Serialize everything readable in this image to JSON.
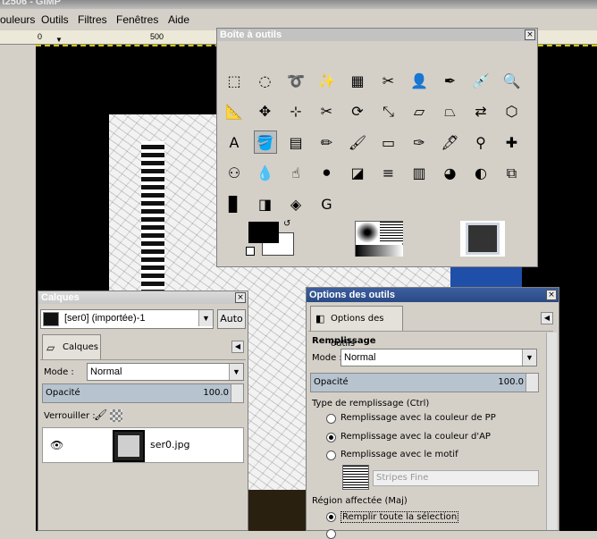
{
  "window": {
    "title": "t2506 - GIMP"
  },
  "menu": [
    "ouleurs",
    "Outils",
    "Filtres",
    "Fenêtres",
    "Aide"
  ],
  "ruler": {
    "tick0": "0",
    "tick500": "500"
  },
  "toolbox": {
    "title": "Boîte à outils",
    "close": "×",
    "tools": [
      {
        "name": "rect-select-icon",
        "glyph": "⬚"
      },
      {
        "name": "ellipse-select-icon",
        "glyph": "◌"
      },
      {
        "name": "lasso-icon",
        "glyph": "➰"
      },
      {
        "name": "fuzzy-select-icon",
        "glyph": "✨"
      },
      {
        "name": "select-by-color-icon",
        "glyph": "▦"
      },
      {
        "name": "scissors-icon",
        "glyph": "✂"
      },
      {
        "name": "foreground-select-icon",
        "glyph": "👤"
      },
      {
        "name": "paths-icon",
        "glyph": "✒"
      },
      {
        "name": "color-picker-icon",
        "glyph": "💉"
      },
      {
        "name": "zoom-icon",
        "glyph": "🔍"
      },
      {
        "name": "measure-icon",
        "glyph": "📐"
      },
      {
        "name": "move-icon",
        "glyph": "✥"
      },
      {
        "name": "align-icon",
        "glyph": "⊹"
      },
      {
        "name": "crop-icon",
        "glyph": "✂"
      },
      {
        "name": "rotate-icon",
        "glyph": "⟳"
      },
      {
        "name": "scale-icon",
        "glyph": "⤡"
      },
      {
        "name": "shear-icon",
        "glyph": "▱"
      },
      {
        "name": "perspective-icon",
        "glyph": "⏢"
      },
      {
        "name": "flip-icon",
        "glyph": "⇄"
      },
      {
        "name": "cage-icon",
        "glyph": "⬡"
      },
      {
        "name": "text-icon",
        "glyph": "A"
      },
      {
        "name": "bucket-fill-icon",
        "glyph": "🪣"
      },
      {
        "name": "blend-icon",
        "glyph": "▤"
      },
      {
        "name": "pencil-icon",
        "glyph": "✏"
      },
      {
        "name": "paintbrush-icon",
        "glyph": "🖌"
      },
      {
        "name": "eraser-icon",
        "glyph": "▭"
      },
      {
        "name": "airbrush-icon",
        "glyph": "✑"
      },
      {
        "name": "ink-icon",
        "glyph": "🖋"
      },
      {
        "name": "clone-icon",
        "glyph": "⚲"
      },
      {
        "name": "heal-icon",
        "glyph": "✚"
      },
      {
        "name": "perspective-clone-icon",
        "glyph": "⚇"
      },
      {
        "name": "blur-icon",
        "glyph": "💧"
      },
      {
        "name": "smudge-icon",
        "glyph": "☝"
      },
      {
        "name": "dodge-burn-icon",
        "glyph": "⚫"
      },
      {
        "name": "desaturate-icon",
        "glyph": "◪"
      },
      {
        "name": "levels-icon",
        "glyph": "≡"
      },
      {
        "name": "colorize-icon",
        "glyph": "▥"
      },
      {
        "name": "color-balance-icon",
        "glyph": "◕"
      },
      {
        "name": "threshold-icon",
        "glyph": "◐"
      },
      {
        "name": "curves-icon",
        "glyph": "⧉"
      },
      {
        "name": "histogram-icon",
        "glyph": "▊"
      },
      {
        "name": "posterize-icon",
        "glyph": "◨"
      },
      {
        "name": "hue-sat-icon",
        "glyph": "◈"
      },
      {
        "name": "gimp-g-icon",
        "glyph": "G"
      }
    ]
  },
  "layers": {
    "title": "Calques",
    "close": "×",
    "image_select": "[ser0] (importée)-1",
    "auto": "Auto",
    "tab": "Calques",
    "mode_label": "Mode :",
    "mode_value": "Normal",
    "opacity_label": "Opacité",
    "opacity_value": "100.0",
    "lock_label": "Verrouiller :",
    "layer_name": "ser0.jpg"
  },
  "tool_options": {
    "title": "Options des outils",
    "close": "×",
    "tab": "Options des outils",
    "section": "Remplissage",
    "mode_label": "Mode :",
    "mode_value": "Normal",
    "opacity_label": "Opacité",
    "opacity_value": "100.0",
    "fill_type_label": "Type de remplissage (Ctrl)",
    "options": [
      "Remplissage avec la couleur de PP",
      "Remplissage avec la couleur d'AP",
      "Remplissage avec le motif"
    ],
    "selected_option": 1,
    "pattern_name": "Stripes Fine",
    "region_label": "Région affectée (Maj)",
    "region_option": "Remplir toute la sélection"
  }
}
